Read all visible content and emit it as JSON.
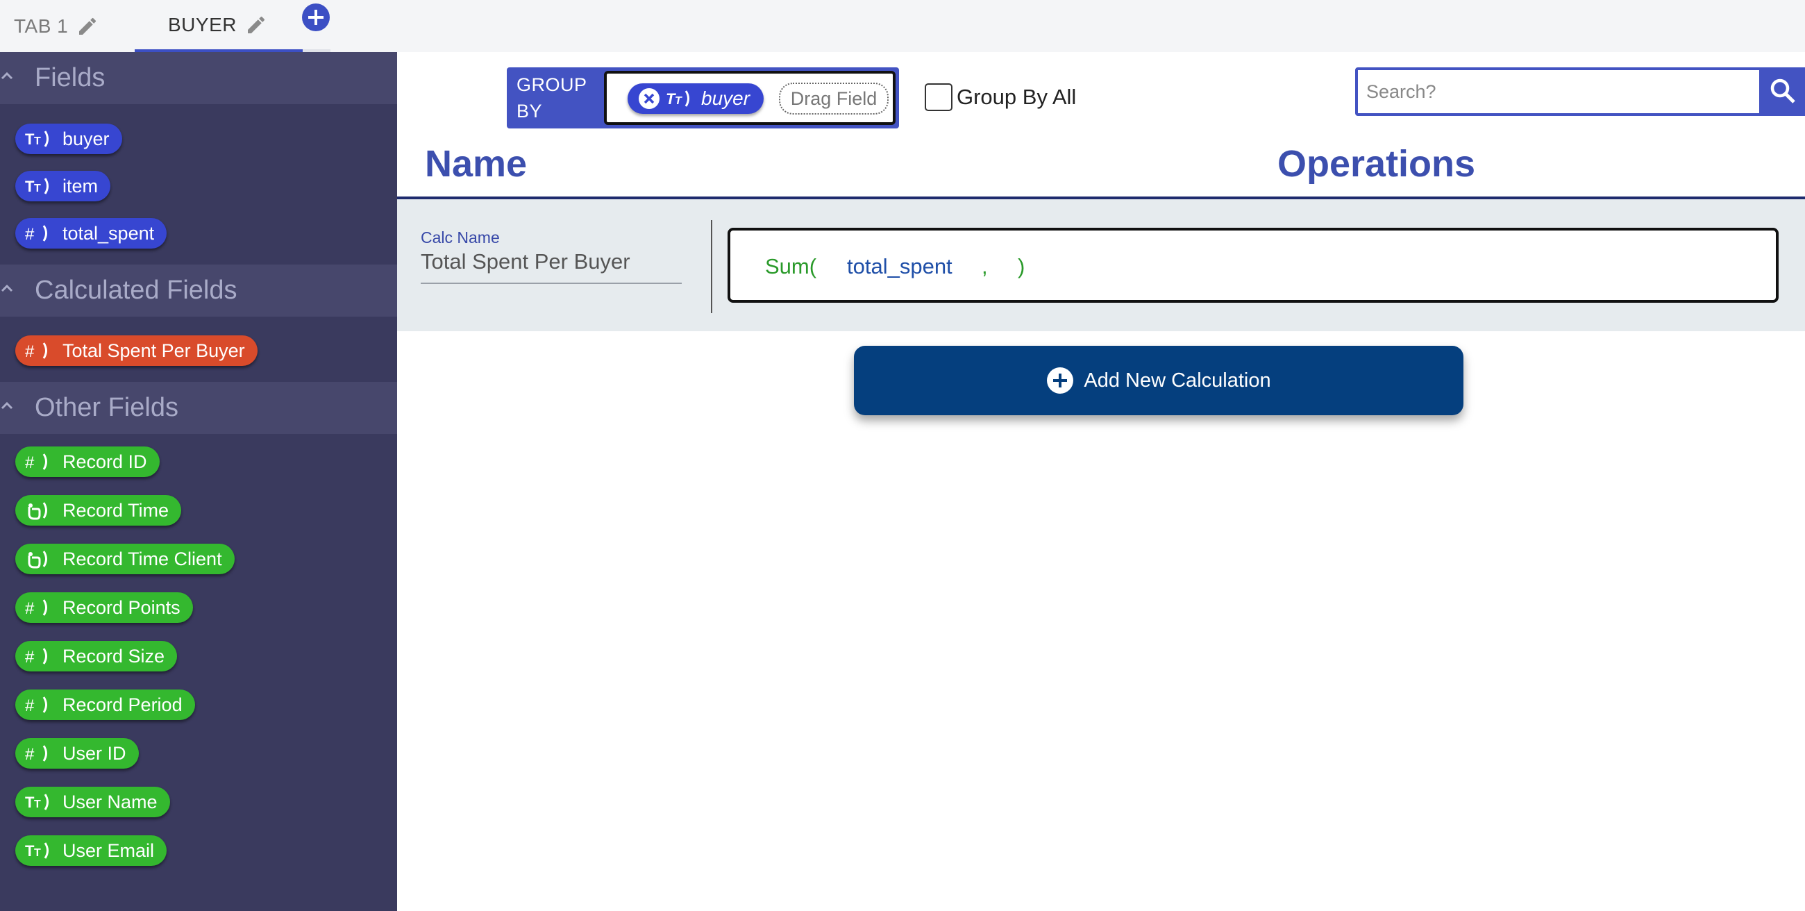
{
  "tabs": [
    {
      "label": "TAB 1",
      "active": false
    },
    {
      "label": "BUYER",
      "active": true
    }
  ],
  "sidebar": {
    "fields_title": "Fields",
    "fields": [
      {
        "label": "buyer",
        "icon": "text-type-icon"
      },
      {
        "label": "item",
        "icon": "text-type-icon"
      },
      {
        "label": "total_spent",
        "icon": "number-type-icon"
      }
    ],
    "calculated_title": "Calculated Fields",
    "calculated": [
      {
        "label": "Total Spent Per Buyer",
        "icon": "number-type-icon"
      }
    ],
    "other_title": "Other Fields",
    "other": [
      {
        "label": "Record ID",
        "icon": "number-type-icon"
      },
      {
        "label": "Record Time",
        "icon": "time-type-icon"
      },
      {
        "label": "Record Time Client",
        "icon": "time-type-icon"
      },
      {
        "label": "Record Points",
        "icon": "number-type-icon"
      },
      {
        "label": "Record Size",
        "icon": "number-type-icon"
      },
      {
        "label": "Record Period",
        "icon": "number-type-icon"
      },
      {
        "label": "User ID",
        "icon": "number-type-icon"
      },
      {
        "label": "User Name",
        "icon": "text-type-icon"
      },
      {
        "label": "User Email",
        "icon": "text-type-icon"
      }
    ]
  },
  "group_by": {
    "label": "GROUP BY",
    "chip": "buyer",
    "drag_placeholder": "Drag Field",
    "group_by_all_label": "Group By All",
    "group_by_all_checked": false
  },
  "search": {
    "placeholder": "Search?"
  },
  "table": {
    "name_header": "Name",
    "operations_header": "Operations",
    "calc_name_label": "Calc Name",
    "calc_name_value": "Total Spent Per Buyer",
    "op_function": "Sum(",
    "op_field": "total_spent",
    "op_comma": ",",
    "op_close": ")"
  },
  "add_calc_label": "Add New Calculation",
  "colors": {
    "accent": "#4353c2",
    "sidebar": "#3a3a5e",
    "field_blue": "#3746d1",
    "calc_red": "#d94b2b",
    "other_green": "#34b82f",
    "add_button": "#053f7e"
  }
}
